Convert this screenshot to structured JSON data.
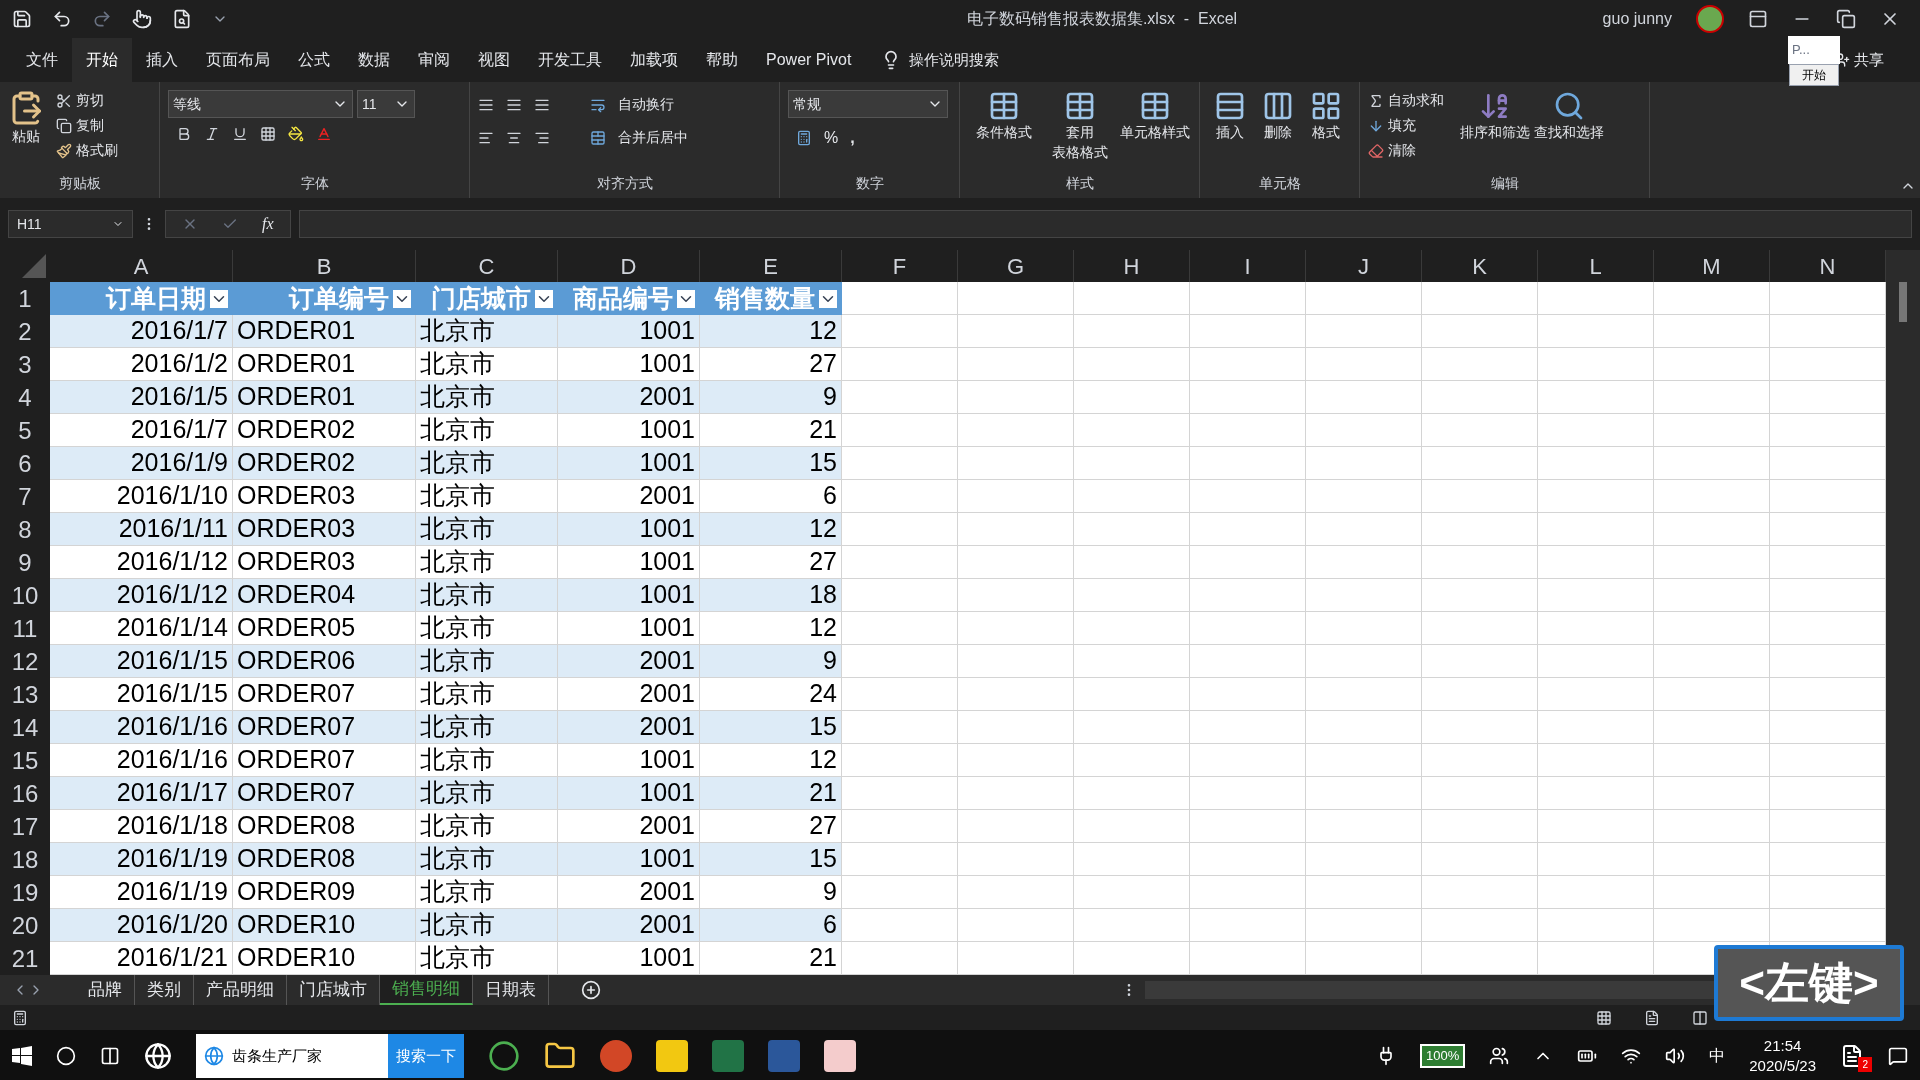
{
  "window": {
    "title": "电子数码销售报表数据集.xlsx  -  Excel",
    "user": "guo junny"
  },
  "menu_tabs": [
    {
      "label": "文件",
      "selected": false
    },
    {
      "label": "开始",
      "selected": true
    },
    {
      "label": "插入",
      "selected": false
    },
    {
      "label": "页面布局",
      "selected": false
    },
    {
      "label": "公式",
      "selected": false
    },
    {
      "label": "数据",
      "selected": false
    },
    {
      "label": "审阅",
      "selected": false
    },
    {
      "label": "视图",
      "selected": false
    },
    {
      "label": "开发工具",
      "selected": false
    },
    {
      "label": "加载项",
      "selected": false
    },
    {
      "label": "帮助",
      "selected": false
    },
    {
      "label": "Power Pivot",
      "selected": false
    }
  ],
  "tell_me": "操作说明搜索",
  "share": "共享",
  "popup": {
    "field": "P...",
    "button": "开始"
  },
  "clipboard": {
    "paste": "粘贴",
    "cut": "剪切",
    "copy": "复制",
    "format_painter": "格式刷",
    "label": "剪贴板"
  },
  "font": {
    "name": "等线",
    "size": "11",
    "label": "字体"
  },
  "alignment": {
    "wrap": "自动换行",
    "merge": "合并后居中",
    "label": "对齐方式"
  },
  "number": {
    "format": "常规",
    "percent": "%",
    "comma": ",",
    "label": "数字"
  },
  "styles": {
    "buttons": [
      {
        "lines": [
          "条件格式"
        ]
      },
      {
        "lines": [
          "套用",
          "表格格式"
        ]
      },
      {
        "lines": [
          "单元格样式"
        ]
      }
    ],
    "label": "样式"
  },
  "cells": {
    "buttons": [
      "插入",
      "删除",
      "格式"
    ],
    "label": "单元格"
  },
  "editing": {
    "autosum": "自动求和",
    "fill": "填充",
    "clear": "清除",
    "sort": "排序和筛选",
    "find": "查找和选择",
    "label": "编辑"
  },
  "formula_bar": {
    "name_box": "H11",
    "fx": "fx"
  },
  "columns": [
    "A",
    "B",
    "C",
    "D",
    "E",
    "F",
    "G",
    "H",
    "I",
    "J",
    "K",
    "L",
    "M",
    "N"
  ],
  "table": {
    "headers": [
      "订单日期",
      "订单编号",
      "门店城市",
      "商品编号",
      "销售数量"
    ],
    "rows": [
      [
        "2016/1/7",
        "ORDER01",
        "北京市",
        "1001",
        "12"
      ],
      [
        "2016/1/2",
        "ORDER01",
        "北京市",
        "1001",
        "27"
      ],
      [
        "2016/1/5",
        "ORDER01",
        "北京市",
        "2001",
        "9"
      ],
      [
        "2016/1/7",
        "ORDER02",
        "北京市",
        "1001",
        "21"
      ],
      [
        "2016/1/9",
        "ORDER02",
        "北京市",
        "1001",
        "15"
      ],
      [
        "2016/1/10",
        "ORDER03",
        "北京市",
        "2001",
        "6"
      ],
      [
        "2016/1/11",
        "ORDER03",
        "北京市",
        "1001",
        "12"
      ],
      [
        "2016/1/12",
        "ORDER03",
        "北京市",
        "1001",
        "27"
      ],
      [
        "2016/1/12",
        "ORDER04",
        "北京市",
        "1001",
        "18"
      ],
      [
        "2016/1/14",
        "ORDER05",
        "北京市",
        "1001",
        "12"
      ],
      [
        "2016/1/15",
        "ORDER06",
        "北京市",
        "2001",
        "9"
      ],
      [
        "2016/1/15",
        "ORDER07",
        "北京市",
        "2001",
        "24"
      ],
      [
        "2016/1/16",
        "ORDER07",
        "北京市",
        "2001",
        "15"
      ],
      [
        "2016/1/16",
        "ORDER07",
        "北京市",
        "1001",
        "12"
      ],
      [
        "2016/1/17",
        "ORDER07",
        "北京市",
        "1001",
        "21"
      ],
      [
        "2016/1/18",
        "ORDER08",
        "北京市",
        "2001",
        "27"
      ],
      [
        "2016/1/19",
        "ORDER08",
        "北京市",
        "1001",
        "15"
      ],
      [
        "2016/1/19",
        "ORDER09",
        "北京市",
        "2001",
        "9"
      ],
      [
        "2016/1/20",
        "ORDER10",
        "北京市",
        "2001",
        "6"
      ],
      [
        "2016/1/21",
        "ORDER10",
        "北京市",
        "1001",
        "21"
      ]
    ]
  },
  "row_numbers": [
    "1",
    "2",
    "3",
    "4",
    "5",
    "6",
    "7",
    "8",
    "9",
    "10",
    "11",
    "12",
    "13",
    "14",
    "15",
    "16",
    "17",
    "18",
    "19",
    "20",
    "21"
  ],
  "sheet_tabs": [
    {
      "label": "品牌",
      "selected": false
    },
    {
      "label": "类别",
      "selected": false
    },
    {
      "label": "产品明细",
      "selected": false
    },
    {
      "label": "门店城市",
      "selected": false
    },
    {
      "label": "销售明细",
      "selected": true
    },
    {
      "label": "日期表",
      "selected": false
    }
  ],
  "overlay": "<左键>",
  "taskbar": {
    "search_text": "齿条生产厂家",
    "search_button": "搜索一下",
    "battery": "100%",
    "ime": "中",
    "time": "21:54",
    "date": "2020/5/23",
    "notifications": "2"
  }
}
